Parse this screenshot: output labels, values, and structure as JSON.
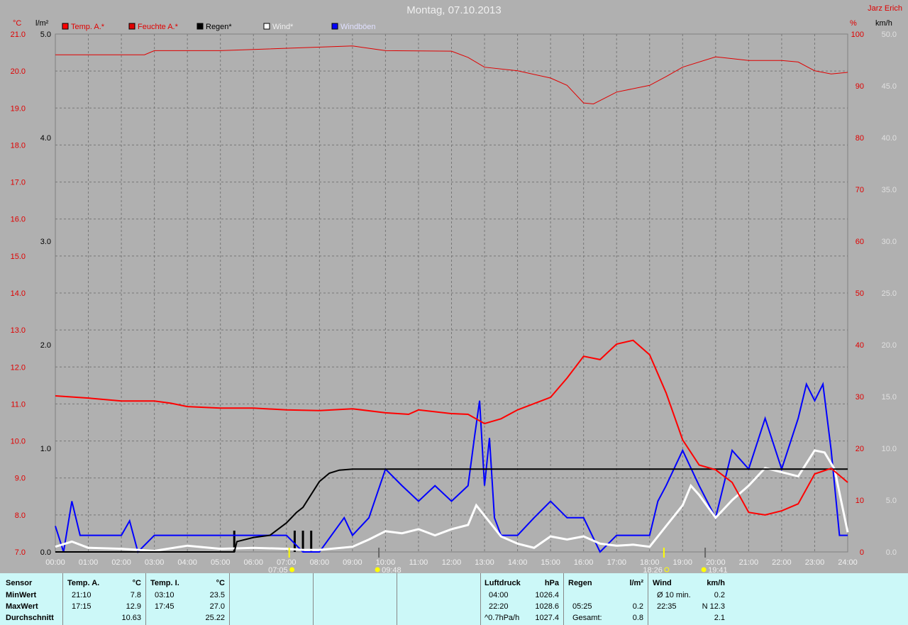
{
  "title": "Montag, 07.10.2013",
  "author": "Jarz Erich",
  "axes": {
    "left1_unit": "°C",
    "left2_unit": "l/m²",
    "right1_unit": "%",
    "right2_unit": "km/h"
  },
  "colors": {
    "temp": "#ff0000",
    "humidity": "#e00000",
    "rain": "#000000",
    "wind": "#ffffff",
    "gust": "#0000ff"
  },
  "chart_data": {
    "type": "line",
    "title": "Montag, 07.10.2013",
    "x_ticks": [
      "00:00",
      "01:00",
      "02:00",
      "03:00",
      "04:00",
      "05:00",
      "06:00",
      "07:00",
      "08:00",
      "09:00",
      "10:00",
      "11:00",
      "12:00",
      "13:00",
      "14:00",
      "15:00",
      "16:00",
      "17:00",
      "18:00",
      "19:00",
      "20:00",
      "21:00",
      "22:00",
      "23:00",
      "24:00"
    ],
    "axes": {
      "temp": [
        7,
        21
      ],
      "rain": [
        0,
        5
      ],
      "humidity": [
        0,
        100
      ],
      "wind": [
        0,
        50
      ]
    },
    "legend": [
      "Temp. A.*",
      "Feuchte A.*",
      "Regen*",
      "Wind*",
      "Windböen"
    ],
    "series": [
      {
        "name": "Temp. A.*",
        "axis": "temp",
        "x": [
          0,
          1,
          2,
          3,
          3.5,
          4,
          5,
          6,
          7,
          8,
          9,
          10,
          10.7,
          11,
          12,
          12.5,
          13,
          13.5,
          14,
          15,
          15.5,
          16,
          16.5,
          17,
          17.5,
          18,
          18.5,
          19,
          19.5,
          20,
          20.5,
          21,
          21.5,
          22,
          22.5,
          23,
          23.5,
          24
        ],
        "y": [
          11.22,
          11.16,
          11.08,
          11.08,
          11.02,
          10.93,
          10.89,
          10.89,
          10.84,
          10.82,
          10.87,
          10.76,
          10.72,
          10.84,
          10.74,
          10.72,
          10.47,
          10.6,
          10.84,
          11.18,
          11.7,
          12.29,
          12.2,
          12.62,
          12.72,
          12.33,
          11.3,
          10.03,
          9.35,
          9.22,
          8.88,
          8.07,
          8.0,
          8.11,
          8.3,
          9.11,
          9.26,
          8.88
        ]
      },
      {
        "name": "Feuchte A.*",
        "axis": "humidity",
        "x": [
          0,
          1,
          2,
          2.7,
          3,
          5,
          9,
          10,
          12,
          12.5,
          13,
          14,
          15,
          15.5,
          16,
          16.3,
          16.6,
          17,
          18,
          18.5,
          19,
          20,
          21,
          22,
          22.5,
          23,
          23.5,
          24
        ],
        "y": [
          96.0,
          96.0,
          96.0,
          96.0,
          96.8,
          96.8,
          97.7,
          96.8,
          96.7,
          95.5,
          93.6,
          92.9,
          91.5,
          90.1,
          86.7,
          86.5,
          87.5,
          88.8,
          90.1,
          91.8,
          93.6,
          95.6,
          94.9,
          94.9,
          94.6,
          92.9,
          92.3,
          92.6
        ]
      },
      {
        "name": "Regen*",
        "axis": "rain",
        "x": [
          0,
          5.42,
          5.5,
          6,
          6.5,
          7,
          7.3,
          7.5,
          7.8,
          8,
          8.3,
          8.6,
          9,
          10,
          24
        ],
        "y": [
          0,
          0,
          0.1,
          0.14,
          0.16,
          0.28,
          0.38,
          0.43,
          0.58,
          0.68,
          0.76,
          0.79,
          0.8,
          0.8,
          0.8
        ]
      },
      {
        "name": "Wind*",
        "axis": "wind",
        "x": [
          0,
          0.5,
          1,
          2,
          3,
          4,
          5,
          6,
          7,
          7.5,
          8,
          9,
          9.5,
          10,
          10.5,
          11,
          11.5,
          12,
          12.5,
          12.75,
          13,
          13.5,
          14,
          14.5,
          15,
          15.5,
          16,
          16.5,
          17,
          17.5,
          18,
          18.5,
          19,
          19.25,
          19.5,
          20,
          20.5,
          21,
          21.5,
          22,
          22.5,
          23,
          23.3,
          23.6,
          24
        ],
        "y": [
          0.5,
          1,
          0.4,
          0.3,
          0.1,
          0.6,
          0.3,
          0.4,
          0.3,
          0.2,
          0.2,
          0.5,
          1.2,
          2,
          1.8,
          2.2,
          1.6,
          2.2,
          2.6,
          4.5,
          3.5,
          1.5,
          0.8,
          0.4,
          1.5,
          1.2,
          1.5,
          0.8,
          0.6,
          0.7,
          0.5,
          2.5,
          4.5,
          6.4,
          5.5,
          3.3,
          5,
          6.4,
          8.1,
          7.7,
          7.3,
          9.8,
          9.6,
          8,
          1.9
        ]
      },
      {
        "name": "Windböen",
        "axis": "wind",
        "x": [
          0,
          0.25,
          0.5,
          0.75,
          1,
          2,
          2.25,
          2.5,
          3,
          4,
          5,
          5.5,
          6,
          7,
          7.5,
          8,
          8.75,
          9,
          9.5,
          10,
          10.5,
          11,
          11.5,
          12,
          12.5,
          12.7,
          12.85,
          13,
          13.15,
          13.3,
          13.5,
          14,
          14.5,
          15,
          15.5,
          16,
          16.5,
          17,
          18,
          18.25,
          18.5,
          19,
          19.5,
          20,
          20.5,
          21,
          21.5,
          22,
          22.5,
          22.75,
          23,
          23.25,
          23.5,
          23.75,
          24
        ],
        "y": [
          2.5,
          0,
          4.9,
          1.6,
          1.6,
          1.6,
          3.0,
          0,
          1.6,
          1.6,
          1.6,
          1.6,
          1.6,
          1.6,
          0,
          0,
          3.3,
          1.6,
          3.3,
          8.0,
          6.4,
          4.9,
          6.4,
          4.9,
          6.4,
          11.2,
          14.6,
          6.4,
          11.0,
          3.3,
          1.6,
          1.6,
          3.3,
          4.9,
          3.3,
          3.3,
          0,
          1.6,
          1.6,
          4.9,
          6.4,
          9.8,
          6.4,
          3.3,
          9.8,
          8.0,
          12.9,
          8.0,
          12.9,
          16.2,
          14.6,
          16.2,
          9.8,
          1.6,
          1.6
        ]
      }
    ],
    "events": [
      {
        "time": "07:05",
        "type": "sunrise"
      },
      {
        "time": "09:48",
        "type": "moonrise"
      },
      {
        "time": "18:26",
        "type": "sunset"
      },
      {
        "time": "19:41",
        "type": "moonset"
      }
    ]
  },
  "table": {
    "sensor": {
      "header": "Sensor",
      "rows": [
        "MinWert",
        "MaxWert",
        "Durchschnitt"
      ]
    },
    "tempA": {
      "header": "Temp. A.",
      "unit": "°C",
      "rows": [
        [
          "21:10",
          "7.8"
        ],
        [
          "17:15",
          "12.9"
        ],
        [
          "",
          "10.63"
        ]
      ]
    },
    "tempI": {
      "header": "Temp. I.",
      "unit": "°C",
      "rows": [
        [
          "03:10",
          "23.5"
        ],
        [
          "17:45",
          "27.0"
        ],
        [
          "",
          "25.22"
        ]
      ]
    },
    "pressure": {
      "header": "Luftdruck",
      "unit": "hPa",
      "rows": [
        [
          "04:00",
          "1026.4"
        ],
        [
          "22:20",
          "1028.6"
        ],
        [
          "^0.7hPa/h",
          "1027.4"
        ]
      ]
    },
    "rain": {
      "header": "Regen",
      "unit": "l/m²",
      "rows": [
        [
          "",
          ""
        ],
        [
          "05:25",
          "0.2"
        ],
        [
          "Gesamt:",
          "0.8"
        ]
      ]
    },
    "wind": {
      "header": "Wind",
      "unit": "km/h",
      "rows": [
        [
          "Ø 10 min.",
          "0.2"
        ],
        [
          "22:35",
          "N 12.3"
        ],
        [
          "",
          "2.1"
        ]
      ]
    }
  }
}
